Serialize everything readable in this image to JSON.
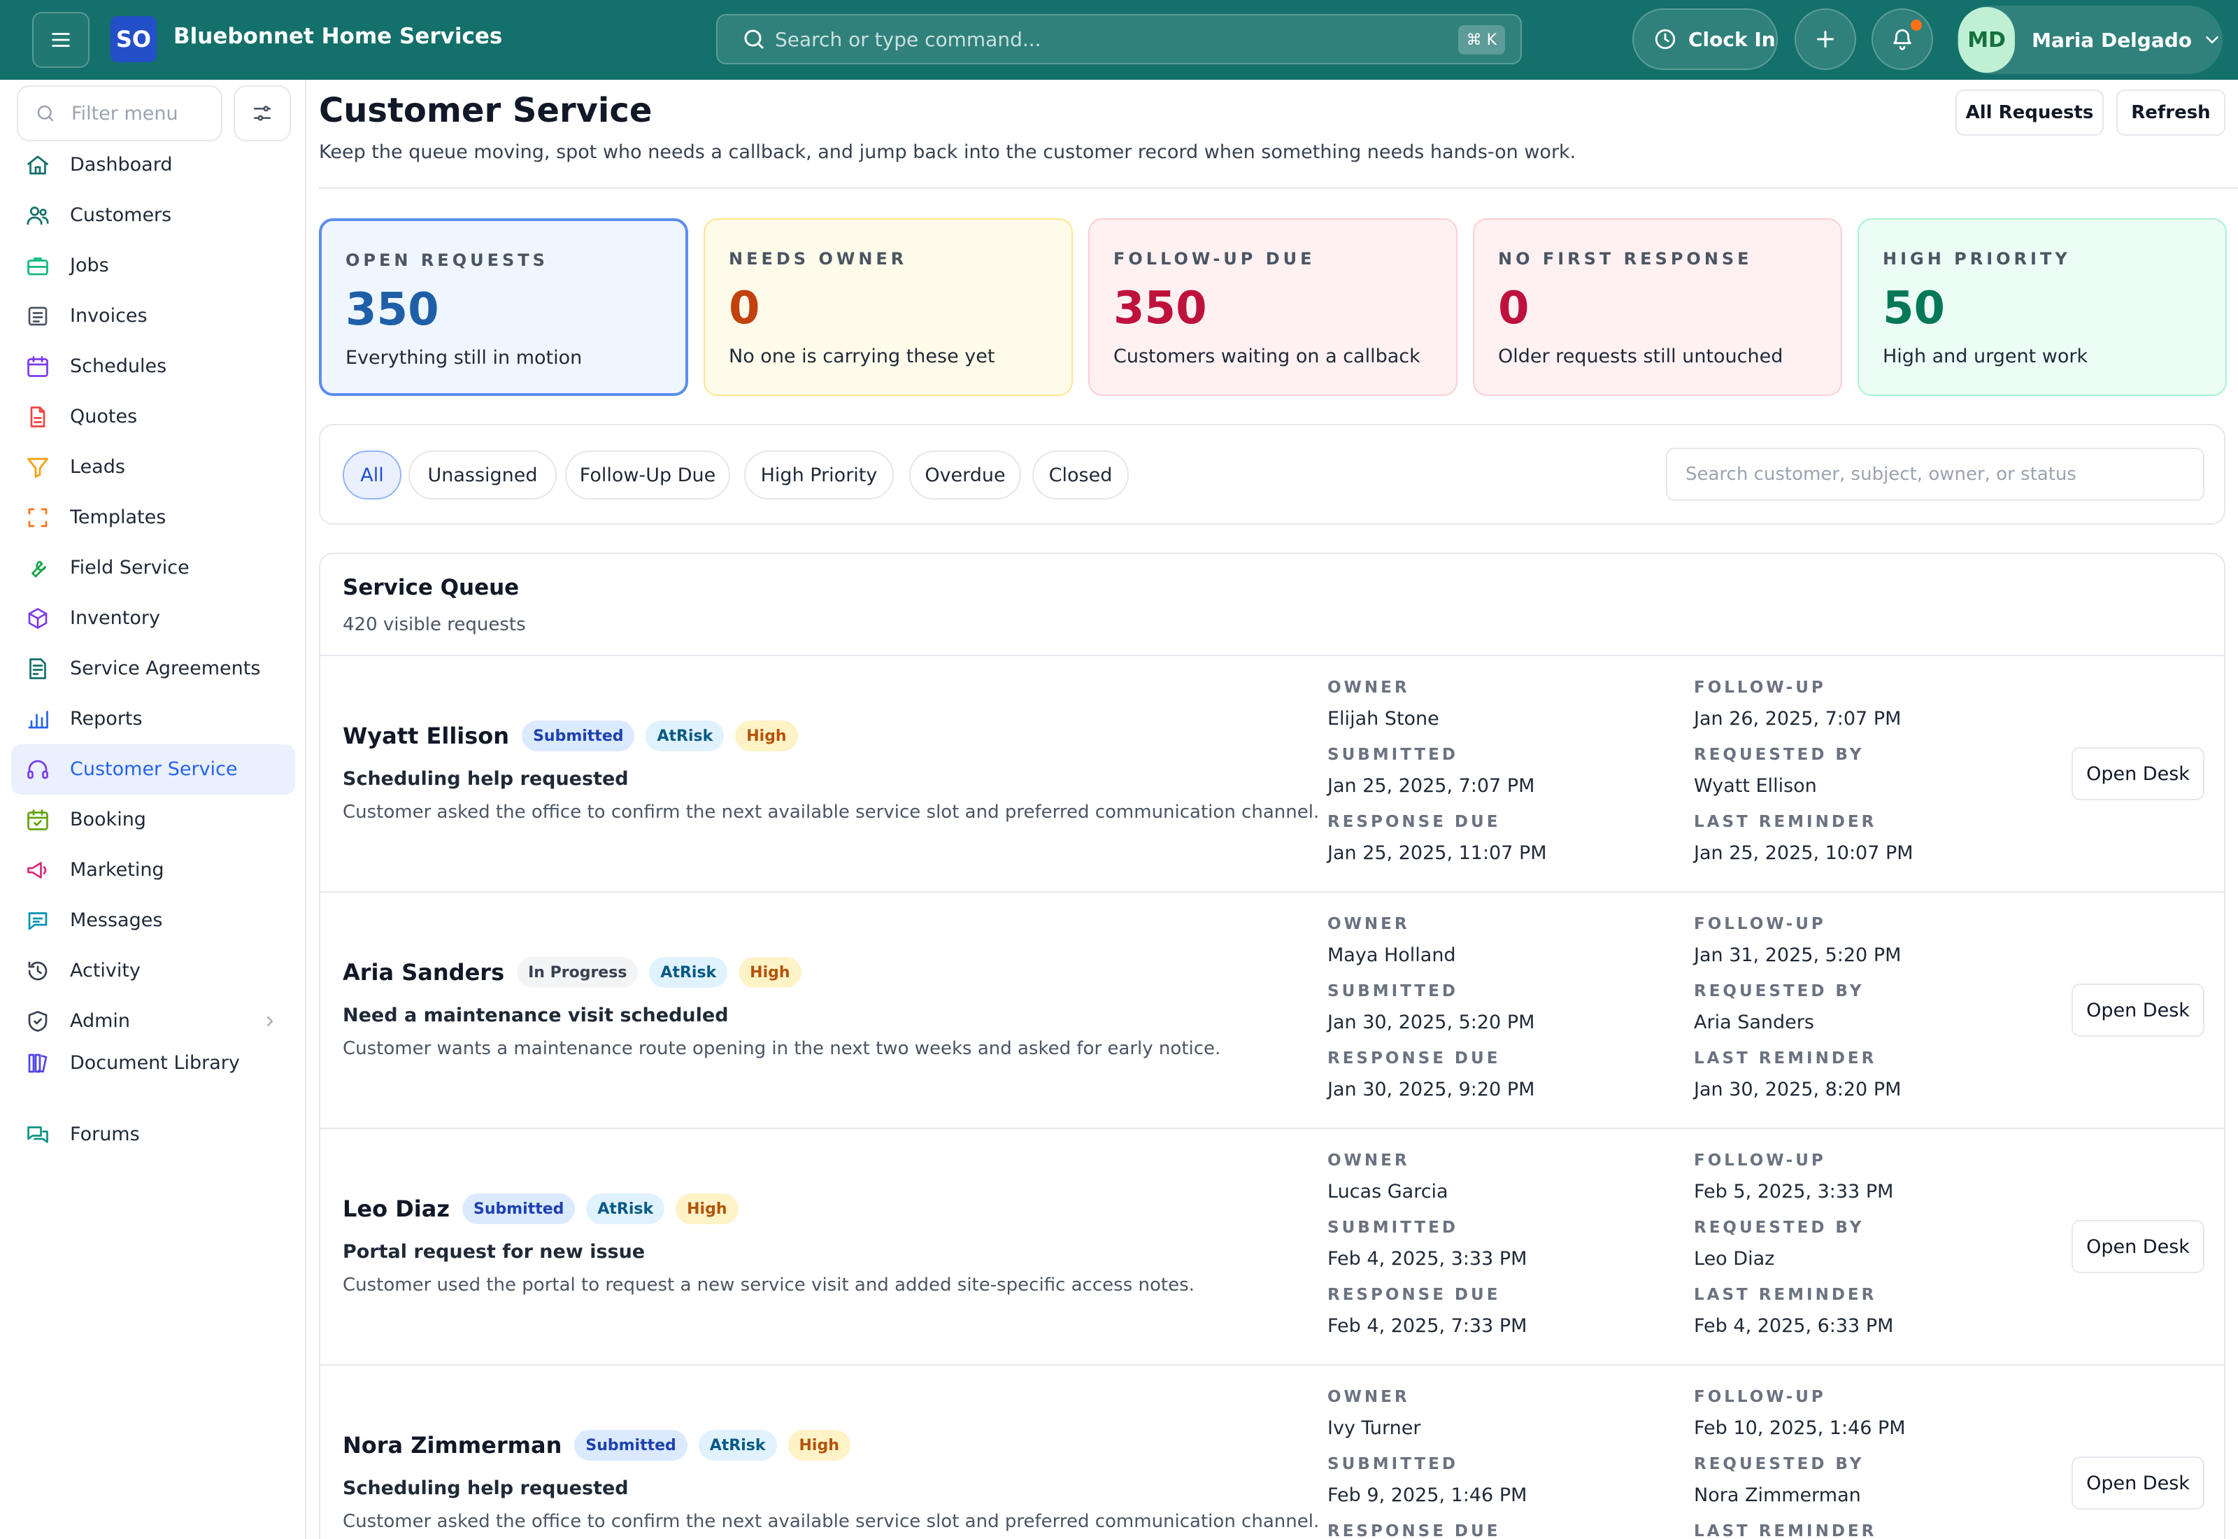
{
  "topbar": {
    "logo_text": "SO",
    "brand": "Bluebonnet Home Services",
    "search_placeholder": "Search or type command...",
    "shortcut": "⌘ K",
    "clock_in_label": "Clock In",
    "user_initials": "MD",
    "user_name": "Maria Delgado",
    "accent_color": "#14706a"
  },
  "sidebar": {
    "filter_placeholder": "Filter menu",
    "items": [
      {
        "label": "Dashboard",
        "icon": "home-icon",
        "color": "#14706a"
      },
      {
        "label": "Customers",
        "icon": "users-icon",
        "color": "#14706a"
      },
      {
        "label": "Jobs",
        "icon": "briefcase-icon",
        "color": "#10b981"
      },
      {
        "label": "Invoices",
        "icon": "receipt-icon",
        "color": "#4b5563"
      },
      {
        "label": "Schedules",
        "icon": "calendar-icon",
        "color": "#7c3aed"
      },
      {
        "label": "Quotes",
        "icon": "document-icon",
        "color": "#ef4444"
      },
      {
        "label": "Leads",
        "icon": "funnel-icon",
        "color": "#f59e0b"
      },
      {
        "label": "Templates",
        "icon": "template-icon",
        "color": "#f97316"
      },
      {
        "label": "Field Service",
        "icon": "wrench-icon",
        "color": "#16a34a"
      },
      {
        "label": "Inventory",
        "icon": "box-icon",
        "color": "#7c3aed"
      },
      {
        "label": "Service Agreements",
        "icon": "contract-icon",
        "color": "#14706a"
      },
      {
        "label": "Reports",
        "icon": "bar-chart-icon",
        "color": "#2563eb"
      },
      {
        "label": "Customer Service",
        "icon": "headset-icon",
        "color": "#7c3aed",
        "active": true
      },
      {
        "label": "Booking",
        "icon": "calendar-check-icon",
        "color": "#65a30d"
      },
      {
        "label": "Marketing",
        "icon": "megaphone-icon",
        "color": "#db2777"
      },
      {
        "label": "Messages",
        "icon": "chat-icon",
        "color": "#0891b2"
      },
      {
        "label": "Activity",
        "icon": "history-icon",
        "color": "#374151"
      },
      {
        "label": "Admin",
        "icon": "shield-icon",
        "color": "#374151"
      },
      {
        "label": "Document Library",
        "icon": "library-icon",
        "color": "#4f46e5"
      },
      {
        "label": "Forums",
        "icon": "forum-icon",
        "color": "#0d9488"
      }
    ]
  },
  "header": {
    "title": "Customer Service",
    "subtitle": "Keep the queue moving, spot who needs a callback, and jump back into the customer record when something needs hands-on work.",
    "all_requests_label": "All Requests",
    "refresh_label": "Refresh"
  },
  "stats": [
    {
      "label": "OPEN REQUESTS",
      "value": "350",
      "desc": "Everything still in motion",
      "bg": "#eff6ff",
      "border": "#5b8def",
      "value_color": "#1e5fa8"
    },
    {
      "label": "NEEDS OWNER",
      "value": "0",
      "desc": "No one is carrying these yet",
      "bg": "#fffbeb",
      "border": "#fde68a",
      "value_color": "#c2410c"
    },
    {
      "label": "FOLLOW-UP DUE",
      "value": "350",
      "desc": "Customers waiting on a callback",
      "bg": "#fff1f2",
      "border": "#fecdd3",
      "value_color": "#be123c"
    },
    {
      "label": "NO FIRST RESPONSE",
      "value": "0",
      "desc": "Older requests still untouched",
      "bg": "#fff1f2",
      "border": "#fecdd3",
      "value_color": "#be123c"
    },
    {
      "label": "HIGH PRIORITY",
      "value": "50",
      "desc": "High and urgent work",
      "bg": "#ecfdf5",
      "border": "#a7f3d0",
      "value_color": "#047857"
    }
  ],
  "filters": {
    "chips": [
      "All",
      "Unassigned",
      "Follow-Up Due",
      "High Priority",
      "Overdue",
      "Closed"
    ],
    "active": "All",
    "search_placeholder": "Search customer, subject, owner, or status"
  },
  "queue": {
    "title": "Service Queue",
    "count_label": "420 visible requests",
    "labels": {
      "owner": "OWNER",
      "submitted": "SUBMITTED",
      "response_due": "RESPONSE DUE",
      "follow_up": "FOLLOW-UP",
      "requested_by": "REQUESTED BY",
      "last_reminder": "LAST REMINDER"
    },
    "open_label": "Open Desk",
    "requests": [
      {
        "name": "Wyatt Ellison",
        "badges": [
          "Submitted",
          "AtRisk",
          "High"
        ],
        "subject": "Scheduling help requested",
        "description": "Customer asked the office to confirm the next available service slot and preferred communication channel.",
        "owner": "Elijah Stone",
        "submitted": "Jan 25, 2025, 7:07 PM",
        "response_due": "Jan 25, 2025, 11:07 PM",
        "follow_up": "Jan 26, 2025, 7:07 PM",
        "requested_by": "Wyatt Ellison",
        "last_reminder": "Jan 25, 2025, 10:07 PM"
      },
      {
        "name": "Aria Sanders",
        "badges": [
          "In Progress",
          "AtRisk",
          "High"
        ],
        "subject": "Need a maintenance visit scheduled",
        "description": "Customer wants a maintenance route opening in the next two weeks and asked for early notice.",
        "owner": "Maya Holland",
        "submitted": "Jan 30, 2025, 5:20 PM",
        "response_due": "Jan 30, 2025, 9:20 PM",
        "follow_up": "Jan 31, 2025, 5:20 PM",
        "requested_by": "Aria Sanders",
        "last_reminder": "Jan 30, 2025, 8:20 PM"
      },
      {
        "name": "Leo Diaz",
        "badges": [
          "Submitted",
          "AtRisk",
          "High"
        ],
        "subject": "Portal request for new issue",
        "description": "Customer used the portal to request a new service visit and added site-specific access notes.",
        "owner": "Lucas Garcia",
        "submitted": "Feb 4, 2025, 3:33 PM",
        "response_due": "Feb 4, 2025, 7:33 PM",
        "follow_up": "Feb 5, 2025, 3:33 PM",
        "requested_by": "Leo Diaz",
        "last_reminder": "Feb 4, 2025, 6:33 PM"
      },
      {
        "name": "Nora Zimmerman",
        "badges": [
          "Submitted",
          "AtRisk",
          "High"
        ],
        "subject": "Scheduling help requested",
        "description": "Customer asked the office to confirm the next available service slot and preferred communication channel.",
        "owner": "Ivy Turner",
        "submitted": "Feb 9, 2025, 1:46 PM",
        "response_due": "",
        "follow_up": "Feb 10, 2025, 1:46 PM",
        "requested_by": "Nora Zimmerman",
        "last_reminder": ""
      }
    ]
  }
}
